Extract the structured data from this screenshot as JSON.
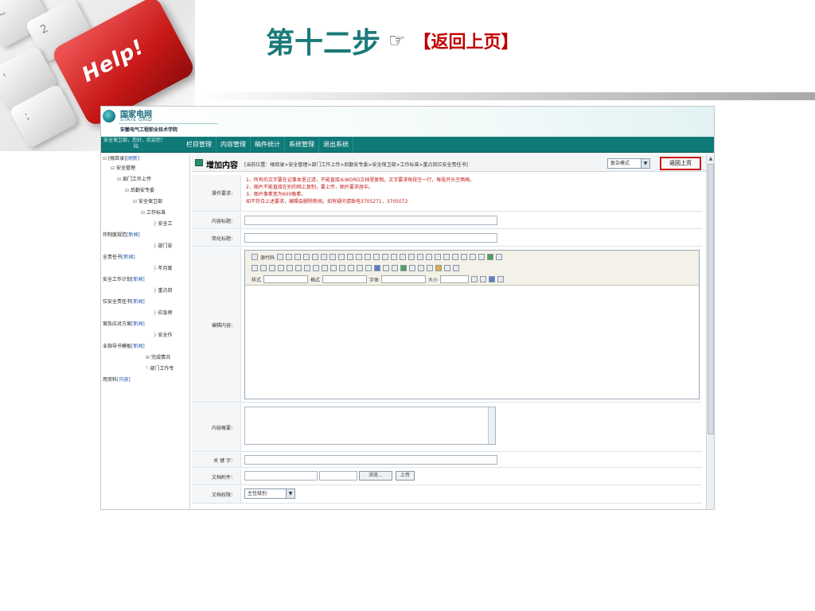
{
  "slide": {
    "title": "第十二步",
    "hand": "☞",
    "back_link": "【返回上页】",
    "help_key_text": "Help!"
  },
  "brand": {
    "name_cn": "国家电网",
    "name_en": "STATE GRID",
    "school": "安徽电气工程职业技术学院"
  },
  "nav": {
    "greeting": "安全保卫部，您好，欢迎您！",
    "greeting2": "陆",
    "items": [
      "栏目管理",
      "内容管理",
      "稿件统计",
      "系统管理",
      "退出系统"
    ]
  },
  "tree": {
    "nodes": [
      {
        "prefix": "⊟",
        "text": "[根目录]",
        "link": "[刷新]"
      },
      {
        "prefix": "⊟",
        "text": "安全管理",
        "link": ""
      },
      {
        "prefix": "⊟",
        "text": "部门工作上传",
        "link": ""
      },
      {
        "prefix": "⊟",
        "text": "后勤安专委",
        "link": ""
      },
      {
        "prefix": "⊟",
        "text": "安全保卫部",
        "link": ""
      },
      {
        "prefix": "⊟",
        "text": "工作标准",
        "link": ""
      },
      {
        "prefix": "├",
        "text": "安全工",
        "link": ""
      },
      {
        "prefix": "",
        "text": "作制度规范",
        "link": "[新闻]"
      },
      {
        "prefix": "├",
        "text": "部门安",
        "link": ""
      },
      {
        "prefix": "",
        "text": "全责任书",
        "link": "[新闻]"
      },
      {
        "prefix": "├",
        "text": "年月度",
        "link": ""
      },
      {
        "prefix": "",
        "text": "安全工作计划",
        "link": "[新闻]"
      },
      {
        "prefix": "├",
        "text": "重点岗",
        "link": ""
      },
      {
        "prefix": "",
        "text": "位安全责任书",
        "link": "[新闻]"
      },
      {
        "prefix": "├",
        "text": "应急预",
        "link": ""
      },
      {
        "prefix": "",
        "text": "案及应对方案",
        "link": "[新闻]"
      },
      {
        "prefix": "├",
        "text": "安全作",
        "link": ""
      },
      {
        "prefix": "",
        "text": "业指导书模板",
        "link": "[新闻]"
      },
      {
        "prefix": "⊞",
        "text": "完成情况",
        "link": ""
      },
      {
        "prefix": "└",
        "text": "部门工作专",
        "link": ""
      },
      {
        "prefix": "",
        "text": "用资料",
        "link": "[内容]"
      }
    ]
  },
  "content": {
    "title": "增加内容",
    "breadcrumb": "[当前位置：根目录>安全管理>部门工作上传>后勤安专委>安全保卫部>工作标准>重点岗位安全责任书]",
    "mode_select": "复杂模式",
    "back_button": "返回上页"
  },
  "form": {
    "requirements_label": "操作要求：",
    "requirements": [
      "1、所有的文字要在记事本里过滤，不能直接从WORD文档里复制。文字要求每段空一行，每段开头空两格。",
      "2、图片不能直接在别的网上复制，要上传，图片要求居中。",
      "3、图片像素宽为600像素。",
      "如不符合上述要求，编辑会删除新闻。如有疑问请致电3705271，3705072"
    ],
    "title_label": "内容标题：",
    "short_title_label": "简化标题：",
    "editor_label": "编辑内容：",
    "summary_label": "内容概要：",
    "keywords_label": "关 键 字：",
    "attachment_label": "文档附件：",
    "browse_button": "浏览...",
    "upload_button": "上传",
    "permission_label": "文档权限：",
    "permission_value": "主任级别"
  },
  "editor": {
    "source_label": "源代码",
    "style_label": "样式",
    "format_label": "格式",
    "font_label": "字体",
    "size_label": "大小"
  },
  "colors": {
    "title_teal": "#1a7a7a",
    "nav_teal": "#0f7a78",
    "back_red": "#c00000",
    "highlight_red": "#d01818"
  }
}
